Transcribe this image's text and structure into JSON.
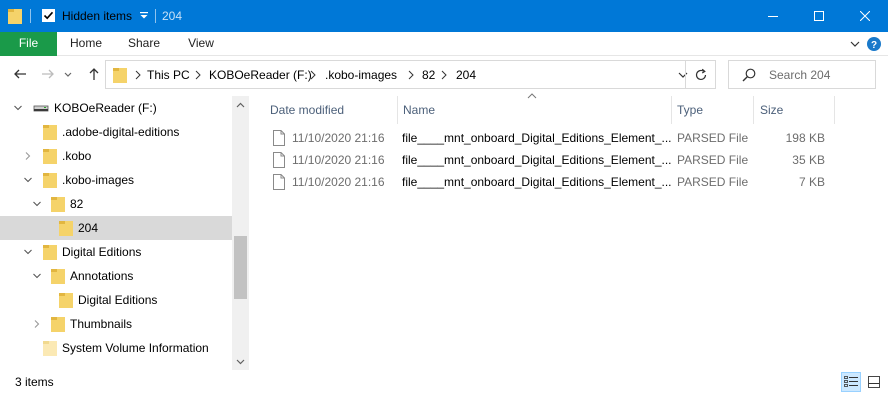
{
  "titlebar": {
    "hidden_items_label": "Hidden items",
    "window_title": "204",
    "accent_color": "#0078d7"
  },
  "ribbon": {
    "tabs": [
      {
        "label": "File"
      },
      {
        "label": "Home"
      },
      {
        "label": "Share"
      },
      {
        "label": "View"
      }
    ]
  },
  "address": {
    "crumbs": [
      "This PC",
      "KOBOeReader (F:)",
      ".kobo-images",
      "82",
      "204"
    ]
  },
  "search": {
    "placeholder": "Search 204"
  },
  "tree": {
    "items": [
      {
        "label": "KOBOeReader (F:)",
        "icon": "drive-icon",
        "arrow": "expanded"
      },
      {
        "label": ".adobe-digital-editions",
        "icon": "folder-icon",
        "arrow": "none"
      },
      {
        "label": ".kobo",
        "icon": "folder-icon",
        "arrow": "collapsed"
      },
      {
        "label": ".kobo-images",
        "icon": "folder-icon",
        "arrow": "expanded"
      },
      {
        "label": "82",
        "icon": "folder-icon",
        "arrow": "expanded"
      },
      {
        "label": "204",
        "icon": "folder-icon",
        "arrow": "none",
        "selected": true
      },
      {
        "label": "Digital Editions",
        "icon": "folder-icon",
        "arrow": "expanded"
      },
      {
        "label": "Annotations",
        "icon": "folder-icon",
        "arrow": "expanded"
      },
      {
        "label": "Digital Editions",
        "icon": "folder-icon",
        "arrow": "none"
      },
      {
        "label": "Thumbnails",
        "icon": "folder-icon",
        "arrow": "collapsed"
      },
      {
        "label": "System Volume Information",
        "icon": "folder-icon",
        "arrow": "none"
      }
    ]
  },
  "filelist": {
    "columns": [
      "Date modified",
      "Name",
      "Type",
      "Size"
    ],
    "rows": [
      {
        "date": "11/10/2020 21:16",
        "name": "file____mnt_onboard_Digital_Editions_Element_...",
        "type": "PARSED File",
        "size": "198 KB"
      },
      {
        "date": "11/10/2020 21:16",
        "name": "file____mnt_onboard_Digital_Editions_Element_...",
        "type": "PARSED File",
        "size": "35 KB"
      },
      {
        "date": "11/10/2020 21:16",
        "name": "file____mnt_onboard_Digital_Editions_Element_...",
        "type": "PARSED File",
        "size": "7 KB"
      }
    ]
  },
  "status": {
    "item_count": "3 items"
  }
}
